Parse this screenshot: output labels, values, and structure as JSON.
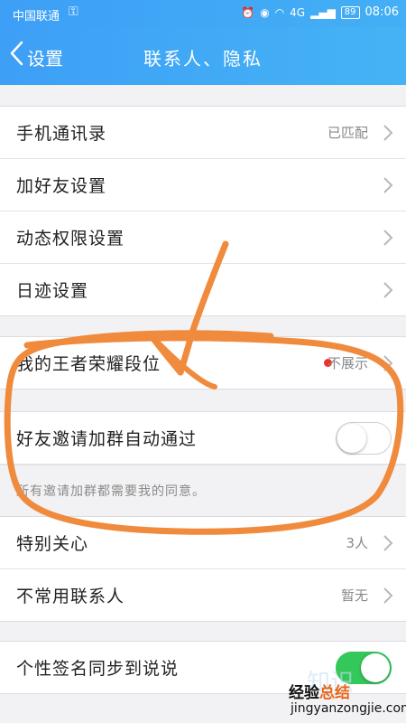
{
  "status_bar": {
    "carrier": "中国联通",
    "battery": "89",
    "time": "08:06",
    "network": "4G"
  },
  "nav": {
    "back_label": "设置",
    "title": "联系人、隐私"
  },
  "group1": [
    {
      "label": "手机通讯录",
      "value": "已匹配"
    },
    {
      "label": "加好友设置",
      "value": ""
    },
    {
      "label": "动态权限设置",
      "value": ""
    },
    {
      "label": "日迹设置",
      "value": ""
    }
  ],
  "group2": {
    "honor": {
      "label": "我的王者荣耀段位",
      "value": "不展示"
    },
    "auto_group": {
      "label": "好友邀请加群自动通过",
      "toggle": "off"
    },
    "hint": "所有邀请加群都需要我的同意。"
  },
  "group3": [
    {
      "label": "特别关心",
      "value": "3人"
    },
    {
      "label": "不常用联系人",
      "value": "暂无"
    }
  ],
  "group4": {
    "signature_sync": {
      "label": "个性签名同步到说说",
      "toggle": "on"
    }
  },
  "watermark": {
    "cn_main": "经验",
    "cn_highlight": "总结",
    "en": "jingyanzongjie.com"
  },
  "colors": {
    "header": "#3d9ff6",
    "toggle_on": "#34c759",
    "annotation": "#f08a3c",
    "red_dot": "#f0302a"
  }
}
